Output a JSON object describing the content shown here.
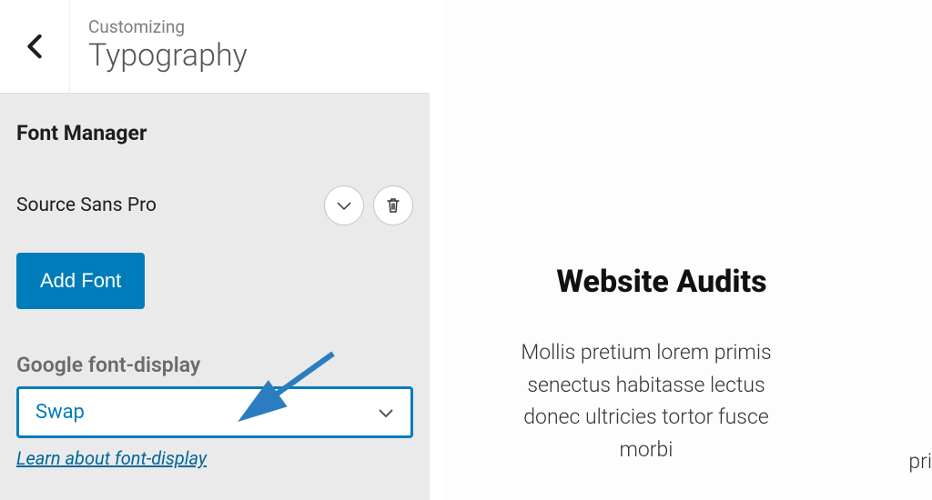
{
  "header": {
    "customizing": "Customizing",
    "section_title": "Typography"
  },
  "font_manager": {
    "heading": "Font Manager",
    "selected_font": "Source Sans Pro",
    "add_font_label": "Add Font"
  },
  "google_font_display": {
    "label": "Google font-display",
    "selected_value": "Swap",
    "help_link_text": "Learn about font-display"
  },
  "preview": {
    "heading": "Website Audits",
    "body": "Mollis pretium lorem primis senectus habitasse lectus donec ultricies tortor fusce morbi",
    "right_fragment": "pri"
  },
  "colors": {
    "primary": "#007cba",
    "link": "#006799"
  }
}
